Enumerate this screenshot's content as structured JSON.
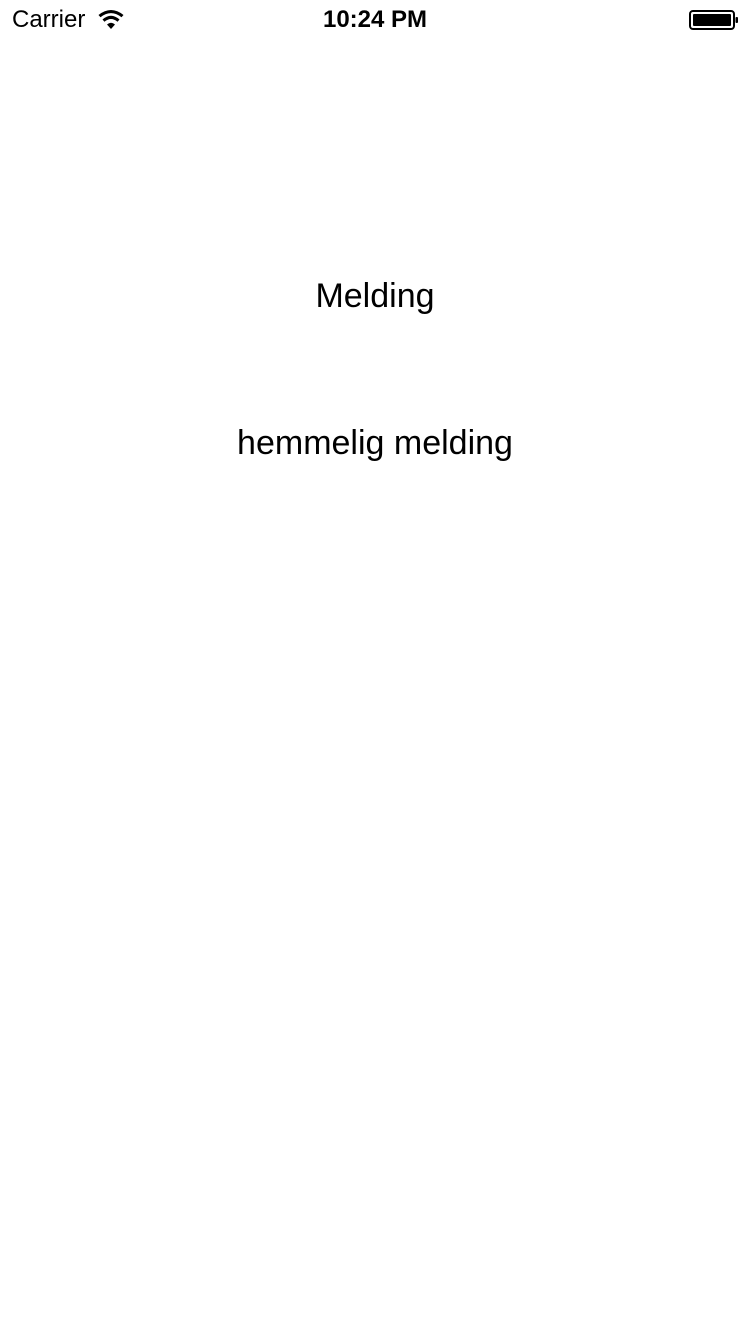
{
  "status_bar": {
    "carrier": "Carrier",
    "time": "10:24 PM",
    "wifi_icon": "wifi-icon",
    "battery_icon": "battery-icon"
  },
  "main": {
    "title": "Melding",
    "message": "hemmelig melding"
  }
}
